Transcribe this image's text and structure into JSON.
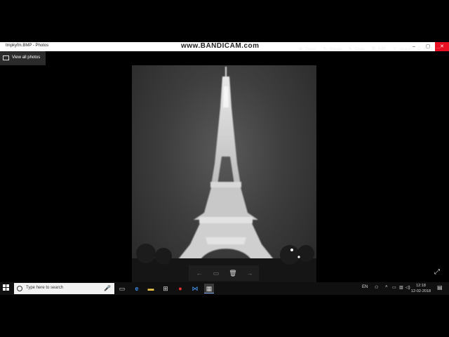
{
  "window": {
    "title": "tmpkyfm.BMP - Photos",
    "watermark": "www.BANDICAM.com",
    "controls": {
      "minimize": "–",
      "maximize": "▢",
      "close": "✕"
    }
  },
  "viewer": {
    "view_all_label": "View all photos",
    "toolbar": [
      {
        "label": "Zoom",
        "icon": "zoom-icon",
        "glyph": "⊕"
      },
      {
        "label": "Rotate",
        "icon": "rotate-icon",
        "glyph": "↻"
      },
      {
        "label": "Draw",
        "icon": "draw-icon",
        "glyph": "✎"
      },
      {
        "label": "Edit",
        "icon": "edit-icon",
        "glyph": "⧉"
      },
      {
        "label": "Share",
        "icon": "share-icon",
        "glyph": "⇪"
      },
      {
        "label": "Print",
        "icon": "print-icon",
        "glyph": "⎙"
      },
      {
        "label": "",
        "icon": "more-icon",
        "glyph": "···"
      }
    ],
    "filmstrip": {
      "prev": "←",
      "slideshow": "▭",
      "delete": "🗑",
      "next": "→"
    },
    "expand_glyph": "⤢"
  },
  "taskbar": {
    "search_placeholder": "Type here to search",
    "language": "EN",
    "time": "12:18",
    "date": "12-02-2018"
  }
}
